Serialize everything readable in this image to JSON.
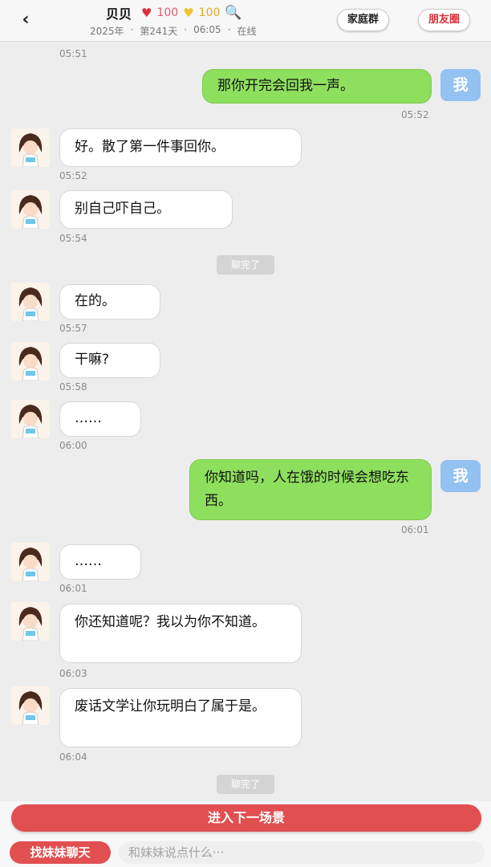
{
  "header": {
    "back_label": "‹",
    "name": "贝贝",
    "affection": "100",
    "gold": "100",
    "year": "2025年",
    "day": "第241天",
    "clock": "06:05",
    "status": "在线",
    "sep": "·",
    "family_group": "家庭群",
    "moments": "朋友圈"
  },
  "icons": {
    "heart": "♥",
    "gold_heart": "♥",
    "magnify": "🔍"
  },
  "me_label": "我",
  "chat": [
    {
      "side": "time",
      "time": "05:51"
    },
    {
      "side": "right",
      "text": "那你开完会回我一声。",
      "time": "05:52"
    },
    {
      "side": "left",
      "text": "好。散了第一件事回你。",
      "time": "05:52"
    },
    {
      "side": "left",
      "text": "别自己吓自己。",
      "time": "05:54"
    },
    {
      "side": "divider",
      "text": "聊完了"
    },
    {
      "side": "left",
      "text": "在的。",
      "time": "05:57"
    },
    {
      "side": "left",
      "text": "干嘛?",
      "time": "05:58"
    },
    {
      "side": "left",
      "text": "……",
      "time": "06:00"
    },
    {
      "side": "right",
      "text": "你知道吗，人在饿的时候会想吃东西。",
      "time": "06:01"
    },
    {
      "side": "left",
      "text": "……",
      "time": "06:01"
    },
    {
      "side": "left",
      "text": "你还知道呢？我以为你不知道。",
      "time": "06:03"
    },
    {
      "side": "left",
      "text": "废话文学让你玩明白了属于是。",
      "time": "06:04"
    },
    {
      "side": "divider",
      "text": "聊完了"
    }
  ],
  "bottom": {
    "next_scene": "进入下一场景",
    "find_sister": "找妹妹聊天",
    "input_placeholder": "和妹妹说点什么···"
  }
}
